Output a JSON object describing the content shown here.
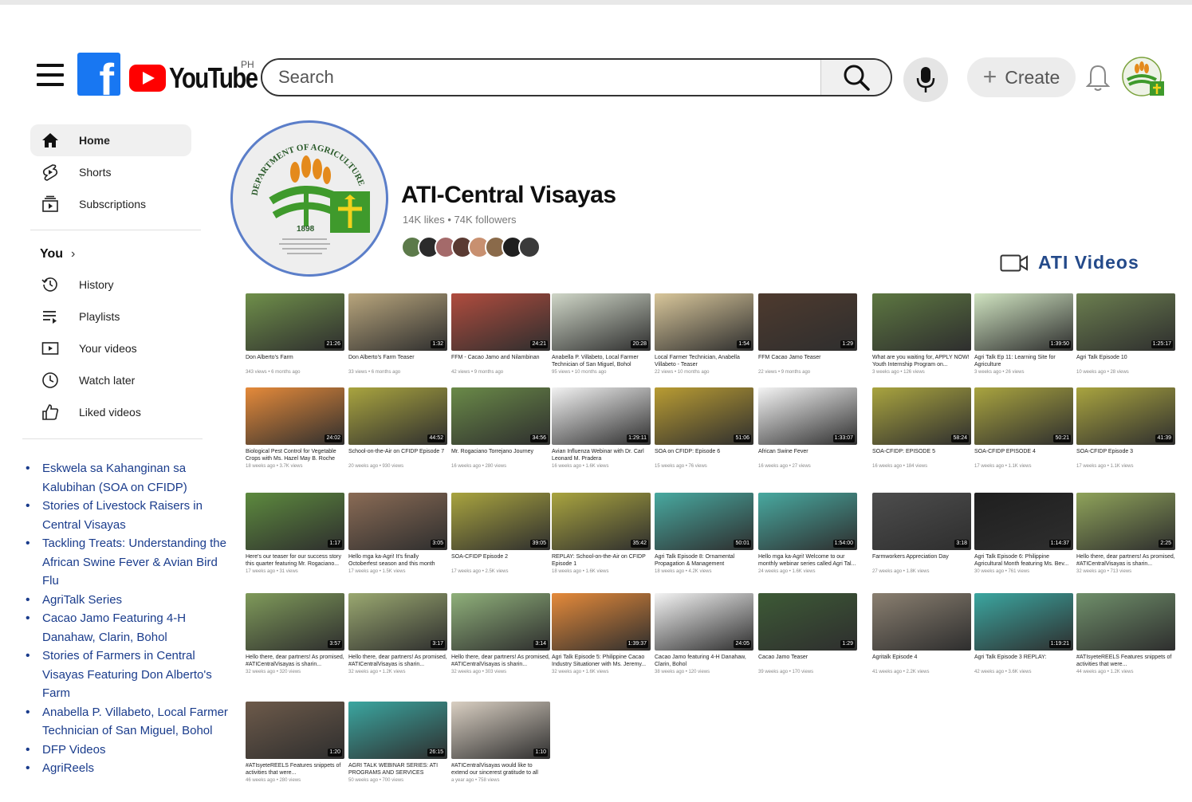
{
  "header": {
    "country_code": "PH",
    "logo_text": "YouTube",
    "search_placeholder": "Search",
    "create_label": "Create"
  },
  "sidebar": {
    "main": [
      {
        "label": "Home",
        "icon": "home-icon"
      },
      {
        "label": "Shorts",
        "icon": "shorts-icon"
      },
      {
        "label": "Subscriptions",
        "icon": "subscriptions-icon"
      }
    ],
    "you_title": "You",
    "you_items": [
      {
        "label": "History",
        "icon": "history-icon"
      },
      {
        "label": "Playlists",
        "icon": "playlists-icon"
      },
      {
        "label": "Your videos",
        "icon": "your-videos-icon"
      },
      {
        "label": "Watch later",
        "icon": "watch-later-icon"
      },
      {
        "label": "Liked videos",
        "icon": "liked-videos-icon"
      }
    ],
    "playlists": [
      "Eskwela sa Kahanginan sa Kalubihan (SOA on CFIDP)",
      "Stories of Livestock Raisers in Central Visayas",
      "Tackling Treats: Understanding the African Swine Fever & Avian Bird Flu",
      "AgriTalk Series",
      "Cacao Jamo Featuring 4-H Danahaw, Clarin, Bohol",
      "Stories of Farmers in Central Visayas Featuring Don Alberto's Farm",
      "Anabella P. Villabeto, Local Farmer Technician of San Miguel, Bohol",
      "DFP Videos",
      "AgriReels"
    ]
  },
  "channel": {
    "name": "ATI-Central Visayas",
    "stats": "14K likes • 74K followers",
    "logo_year": "1898",
    "logo_arc_text": "DEPARTMENT OF AGRICULTURE",
    "videos_label": "ATI Videos"
  },
  "videos": [
    {
      "title": "Don Alberto's Farm",
      "meta": "343 views • 6 months ago",
      "dur": "21:26",
      "bg": "#6f8f4a"
    },
    {
      "title": "Don Alberto's Farm Teaser",
      "meta": "33 views • 6 months ago",
      "dur": "1:32",
      "bg": "#b8a57c"
    },
    {
      "title": "FFM - Cacao Jamo and Nilambinan",
      "meta": "42 views • 9 months ago",
      "dur": "24:21",
      "bg": "#b04c3e"
    },
    {
      "title": "Anabella P. Villabeto, Local Farmer Technician of San Miguel, Bohol",
      "meta": "95 views • 10 months ago",
      "dur": "20:28",
      "bg": "#cfd6c7"
    },
    {
      "title": "Local Farmer Technician, Anabella Villabeto - Teaser",
      "meta": "22 views • 10 months ago",
      "dur": "1:54",
      "bg": "#d8c69a"
    },
    {
      "title": "FFM Cacao Jamo Teaser",
      "meta": "22 views • 9 months ago",
      "dur": "1:29",
      "bg": "#4e3a2e"
    },
    {
      "title": "What are you waiting for, APPLY NOW! Youth Internship Program on...",
      "meta": "3 weeks ago • 126 views",
      "dur": "",
      "bg": "#5d7741"
    },
    {
      "title": "Agri Talk Ep 11: Learning Site for Agriculture",
      "meta": "3 weeks ago • 26 views",
      "dur": "1:39:50",
      "bg": "#cfe3c0"
    },
    {
      "title": "Agri Talk Episode 10",
      "meta": "10 weeks ago • 28 views",
      "dur": "1:25:17",
      "bg": "#6b7e4f"
    },
    {
      "title": "Biological Pest Control for Vegetable Crops with Ms. Hazel May B. Roche",
      "meta": "18 weeks ago • 3.7K views",
      "dur": "24:02",
      "bg": "#e58a3a"
    },
    {
      "title": "School-on-the-Air on CFIDP Episode 7",
      "meta": "20 weeks ago • 930 views",
      "dur": "44:52",
      "bg": "#a9a43f"
    },
    {
      "title": "Mr. Rogaciano Torrejano Journey",
      "meta": "16 weeks ago • 280 views",
      "dur": "34:56",
      "bg": "#6a8a48"
    },
    {
      "title": "Avian Influenza Webinar with Dr. Carl Leonard M. Pradera",
      "meta": "16 weeks ago • 1.6K views",
      "dur": "1:29:11",
      "bg": "#f2f2f2"
    },
    {
      "title": "SOA on CFIDP: Episode 6",
      "meta": "15 weeks ago • 76 views",
      "dur": "51:06",
      "bg": "#b99c33"
    },
    {
      "title": "African Swine Fever",
      "meta": "16 weeks ago • 27 views",
      "dur": "1:33:07",
      "bg": "#f4f4f4"
    },
    {
      "title": "SOA-CFIDP: EPISODE 5",
      "meta": "16 weeks ago • 184 views",
      "dur": "58:24",
      "bg": "#a9a43f"
    },
    {
      "title": "SOA-CFIDP EPISODE 4",
      "meta": "17 weeks ago • 1.1K views",
      "dur": "50:21",
      "bg": "#a9a43f"
    },
    {
      "title": "SOA-CFIDP Episode 3",
      "meta": "17 weeks ago • 1.1K views",
      "dur": "41:39",
      "bg": "#a9a43f"
    },
    {
      "title": "Here's our teaser for our success story this quarter featuring Mr. Rogaciano...",
      "meta": "17 weeks ago • 31 views",
      "dur": "1:17",
      "bg": "#5d8a3e"
    },
    {
      "title": "Hello mga ka-Agri! It's finally Octoberfest season and this month we...",
      "meta": "17 weeks ago • 1.5K views",
      "dur": "3:05",
      "bg": "#8a6b55"
    },
    {
      "title": "SOA-CFIDP Episode 2",
      "meta": "17 weeks ago • 2.5K views",
      "dur": "39:05",
      "bg": "#a9a43f"
    },
    {
      "title": "REPLAY: School-on-the-Air on CFIDP Episode 1",
      "meta": "18 weeks ago • 1.6K views",
      "dur": "35:42",
      "bg": "#a9a43f"
    },
    {
      "title": "Agri Talk Episode 8: Ornamental Propagation & Management",
      "meta": "18 weeks ago • 4.2K views",
      "dur": "50:01",
      "bg": "#48a9a0"
    },
    {
      "title": "Hello mga ka-Agri! Welcome to our monthly webinar series called Agri Tal...",
      "meta": "24 weeks ago • 1.6K views",
      "dur": "1:54:00",
      "bg": "#48a9a0"
    },
    {
      "title": "Farmworkers Appreciation Day",
      "meta": "27 weeks ago • 1.8K views",
      "dur": "3:18",
      "bg": "#4d4d4d"
    },
    {
      "title": "Agri Talk Episode 6: Philippine Agricultural Month featuring Ms. Bev...",
      "meta": "30 weeks ago • 761 views",
      "dur": "1:14:37",
      "bg": "#1f1f1f"
    },
    {
      "title": "Hello there, dear partners! As promised, #ATICentralVisayas is sharin...",
      "meta": "32 weeks ago • 713 views",
      "dur": "2:25",
      "bg": "#8fa35a"
    },
    {
      "title": "Hello there, dear partners! As promised, #ATICentralVisayas is sharin...",
      "meta": "32 weeks ago • 320 views",
      "dur": "3:57",
      "bg": "#7f9a5a"
    },
    {
      "title": "Hello there, dear partners! As promised, #ATICentralVisayas is sharin...",
      "meta": "32 weeks ago • 1.2K views",
      "dur": "3:17",
      "bg": "#9aa870"
    },
    {
      "title": "Hello there, dear partners! As promised, #ATICentralVisayas is sharin...",
      "meta": "32 weeks ago • 303 views",
      "dur": "3:14",
      "bg": "#8fb07a"
    },
    {
      "title": "Agri Talk Episode 5: Philippine Cacao Industry Situationer with Ms. Jeremy...",
      "meta": "32 weeks ago • 1.6K views",
      "dur": "1:39:37",
      "bg": "#e58a3a"
    },
    {
      "title": "Cacao Jamo featuring 4-H Danahaw, Clarin, Bohol",
      "meta": "38 weeks ago • 120 views",
      "dur": "24:05",
      "bg": "#f3f3f3"
    },
    {
      "title": "Cacao Jamo Teaser",
      "meta": "39 weeks ago • 170 views",
      "dur": "1:29",
      "bg": "#3d5a36"
    },
    {
      "title": "Agritalk Episode 4",
      "meta": "41 weeks ago • 2.2K views",
      "dur": "",
      "bg": "#8a7f70"
    },
    {
      "title": "Agri Talk Episode 3 REPLAY:",
      "meta": "42 weeks ago • 3.6K views",
      "dur": "1:19:21",
      "bg": "#3ba6a0"
    },
    {
      "title": "#ATIsyeteREELS Features snippets of activities that were...",
      "meta": "44 weeks ago • 1.2K views",
      "dur": "",
      "bg": "#6f8f6a"
    },
    {
      "title": "#ATIsyeteREELS Features snippets of activities that were...",
      "meta": "46 weeks ago • 280 views",
      "dur": "1:20",
      "bg": "#6d5a4a"
    },
    {
      "title": "AGRI TALK WEBINAR SERIES: ATI PROGRAMS AND SERVICES SPEAKER...",
      "meta": "50 weeks ago • 700 views",
      "dur": "26:15",
      "bg": "#3ba6a0"
    },
    {
      "title": "#ATICentralVisayas would like to extend our sincerest gratitude to all our...",
      "meta": "a year ago • 758 views",
      "dur": "1:10",
      "bg": "#d9cfc2"
    }
  ],
  "colors": {
    "accent_blue": "#1a3c8c",
    "youtube_red": "#ff0000",
    "facebook_blue": "#1877f2",
    "eskwelahan_gold": "#e9d44a"
  }
}
